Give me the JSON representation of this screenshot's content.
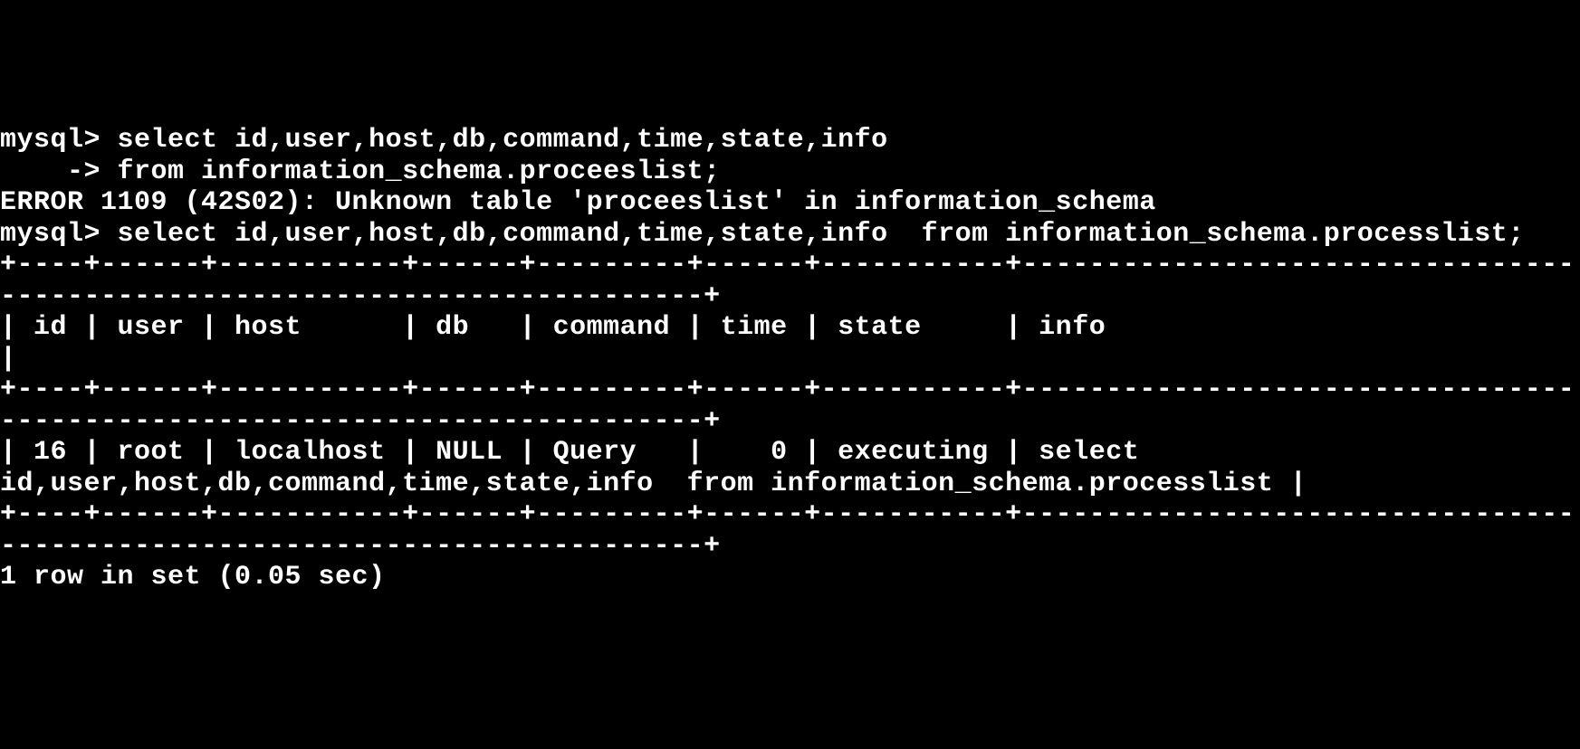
{
  "terminal": {
    "line1": "mysql> select id,user,host,db,command,time,state,info",
    "line2": "    -> from information_schema.proceeslist;",
    "line3": "ERROR 1109 (42S02): Unknown table 'proceeslist' in information_schema",
    "line4": "mysql> select id,user,host,db,command,time,state,info  from information_schema.processlist;",
    "line5": "+----+------+-----------+------+---------+------+-----------+---------------------------------------------------------------------------+",
    "line6": "| id | user | host      | db   | command | time | state     | info                                                                      |",
    "line7": "+----+------+-----------+------+---------+------+-----------+---------------------------------------------------------------------------+",
    "line8": "| 16 | root | localhost | NULL | Query   |    0 | executing | select id,user,host,db,command,time,state,info  from information_schema.processlist |",
    "line9": "+----+------+-----------+------+---------+------+-----------+---------------------------------------------------------------------------+",
    "line10": "1 row in set (0.05 sec)"
  },
  "query_1": {
    "prompt": "mysql>",
    "continuation": "->",
    "sql": "select id,user,host,db,command,time,state,info from information_schema.proceeslist;"
  },
  "error": {
    "code": "1109",
    "sqlstate": "42S02",
    "message": "Unknown table 'proceeslist' in information_schema"
  },
  "query_2": {
    "prompt": "mysql>",
    "sql": "select id,user,host,db,command,time,state,info  from information_schema.processlist;"
  },
  "result_table": {
    "columns": [
      "id",
      "user",
      "host",
      "db",
      "command",
      "time",
      "state",
      "info"
    ],
    "rows": [
      {
        "id": "16",
        "user": "root",
        "host": "localhost",
        "db": "NULL",
        "command": "Query",
        "time": "0",
        "state": "executing",
        "info": "select id,user,host,db,command,time,state,info  from information_schema.processlist"
      }
    ]
  },
  "result_footer": {
    "row_count": "1",
    "duration": "0.05 sec"
  }
}
